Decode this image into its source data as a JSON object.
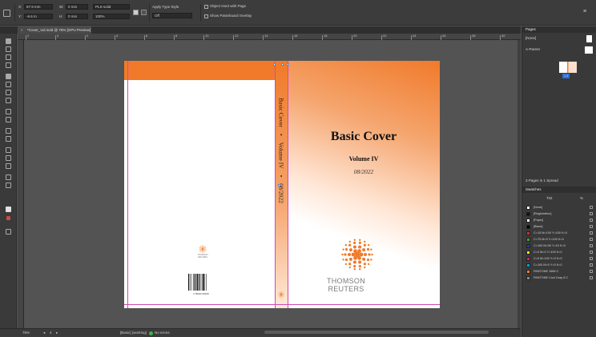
{
  "control_bar": {
    "x_value": "67.9 mm",
    "y_value": "-6.6 m",
    "w_value": "0 mm",
    "h_value": "0 mm",
    "stroke_style": "PLS-solid",
    "opacity": "100%",
    "fx_label": "fx",
    "apply_type_style": "Apply Type Style",
    "type_style_value": "Off",
    "checkbox_1": "Object Inset with Page",
    "checkbox_2": "Show Pasteboard Overlay"
  },
  "document_tab": {
    "title": "*Cover_Vol.indd @ 75% [GPU Preview]",
    "close": "×"
  },
  "ruler": {
    "marks": [
      "2",
      "0",
      "2",
      "4",
      "6",
      "8",
      "10",
      "12",
      "14",
      "16",
      "18",
      "20",
      "22",
      "24",
      "26",
      "28",
      "30"
    ]
  },
  "spine": {
    "text": [
      "Basic Cover",
      "•",
      "Volume IV",
      "•",
      "08/2022"
    ]
  },
  "cover": {
    "title": "Basic Cover",
    "volume": "Volume IV",
    "date": "08/2022",
    "company_line1": "THOMSON",
    "company_line2": "REUTERS",
    "back_company": "THOMSON REUTERS",
    "barcode_digits": "9 780000 000000"
  },
  "status_bar": {
    "zoom": "75%",
    "page_nav": "4",
    "style": "[Basic] (working)",
    "errors": "No errors"
  },
  "panels": {
    "pages_title": "Pages",
    "pages_none": "[None]",
    "pages_master": "A-Parent",
    "spread_label": "1-3",
    "pages_footer": "3 Pages in 1 Spread",
    "swatches_title": "Swatches",
    "tint_label": "Tint",
    "tint_value": "%",
    "swatches": [
      {
        "name": "[None]",
        "color": "#ffffff"
      },
      {
        "name": "[Registration]",
        "color": "#111111"
      },
      {
        "name": "[Paper]",
        "color": "#ffffff"
      },
      {
        "name": "[Black]",
        "color": "#000000"
      },
      {
        "name": "C=15 M=100 Y=100 K=0",
        "color": "#d92d2a"
      },
      {
        "name": "C=75 M=5 Y=100 K=0",
        "color": "#3ea13d"
      },
      {
        "name": "C=100 M=90 Y=10 K=0",
        "color": "#2a3a8f"
      },
      {
        "name": "C=0 M=0 Y=100 K=0",
        "color": "#f5e614"
      },
      {
        "name": "C=0 M=100 Y=0 K=0",
        "color": "#d61f7b"
      },
      {
        "name": "C=100 M=0 Y=0 K=0",
        "color": "#0c9fd9"
      },
      {
        "name": "PANTONE 1585 C",
        "color": "#f07a2a"
      },
      {
        "name": "PANTONE Cool Gray 8 C",
        "color": "#8a8a8a"
      }
    ]
  }
}
